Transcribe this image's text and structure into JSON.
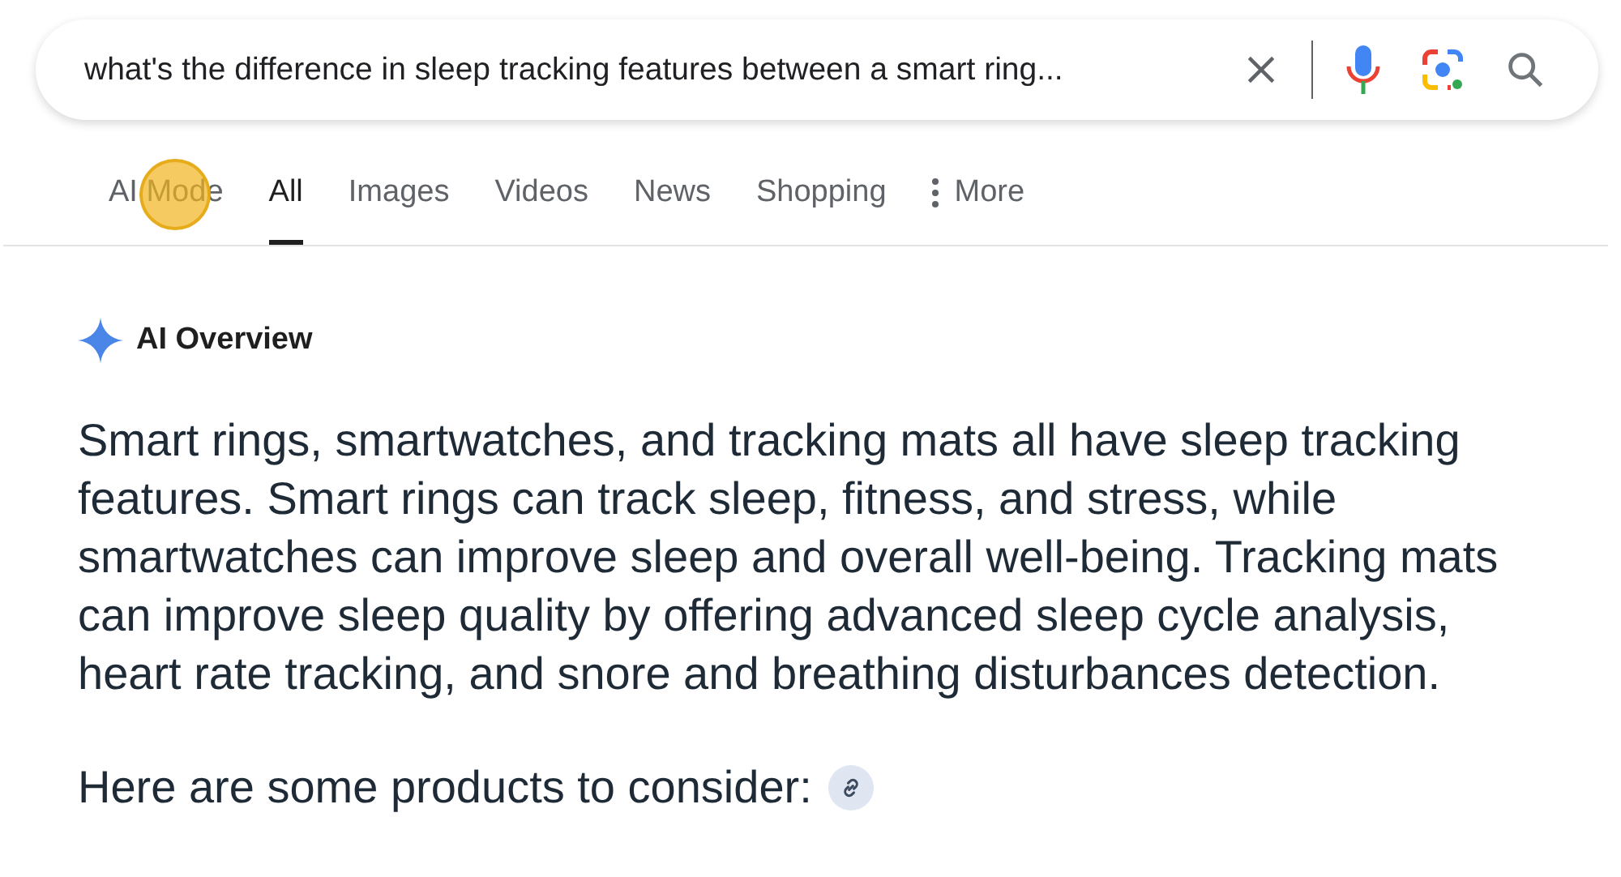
{
  "search": {
    "value": "what's the difference in sleep tracking features between a smart ring..."
  },
  "tabs": [
    {
      "label": "AI Mode",
      "selected": false,
      "highlighted": true
    },
    {
      "label": "All",
      "selected": true,
      "highlighted": false
    },
    {
      "label": "Images",
      "selected": false,
      "highlighted": false
    },
    {
      "label": "Videos",
      "selected": false,
      "highlighted": false
    },
    {
      "label": "News",
      "selected": false,
      "highlighted": false
    },
    {
      "label": "Shopping",
      "selected": false,
      "highlighted": false
    },
    {
      "label": "More",
      "selected": false,
      "highlighted": false,
      "kind": "menu"
    }
  ],
  "overview": {
    "title": "AI Overview",
    "paragraph": "Smart rings, smartwatches, and tracking mats all have sleep tracking features. Smart rings can track sleep, fitness, and stress, while smartwatches can improve sleep and overall well-being. Tracking mats can improve sleep quality by offering advanced sleep cycle analysis, heart rate tracking, and snore and breathing disturbances detection.",
    "lead_in": "Here are some products to consider:"
  }
}
